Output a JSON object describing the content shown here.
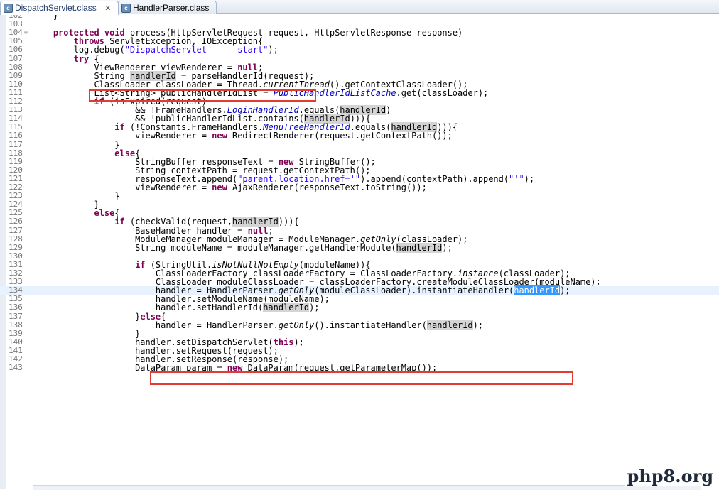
{
  "tabs": [
    {
      "label": "DispatchServlet.class",
      "icon": "class-file-icon",
      "active": true
    },
    {
      "label": "HandlerParser.class",
      "icon": "class-file-icon",
      "active": false
    }
  ],
  "watermark": "php8.org",
  "lines": [
    {
      "n": "102",
      "segs": [
        [
          "",
          "    }"
        ]
      ]
    },
    {
      "n": "103",
      "segs": []
    },
    {
      "n": "104",
      "fold": "⊖",
      "segs": [
        [
          "",
          "    "
        ],
        [
          "k",
          "protected"
        ],
        [
          "",
          " "
        ],
        [
          "k",
          "void"
        ],
        [
          "",
          " process(HttpServletRequest request, HttpServletResponse response)"
        ]
      ]
    },
    {
      "n": "105",
      "segs": [
        [
          "",
          "        "
        ],
        [
          "k",
          "throws"
        ],
        [
          "",
          " ServletException, IOException{"
        ]
      ]
    },
    {
      "n": "106",
      "segs": [
        [
          "",
          "        log.debug("
        ],
        [
          "s",
          "\"DispatchServlet------start\""
        ],
        [
          "",
          ");"
        ]
      ]
    },
    {
      "n": "107",
      "segs": [
        [
          "",
          "        "
        ],
        [
          "k",
          "try"
        ],
        [
          "",
          " {"
        ]
      ]
    },
    {
      "n": "108",
      "segs": [
        [
          "",
          "            ViewRenderer viewRenderer = "
        ],
        [
          "k",
          "null"
        ],
        [
          "",
          ";"
        ]
      ]
    },
    {
      "n": "109",
      "segs": [
        [
          "",
          "            String "
        ],
        [
          "occ",
          "handlerId"
        ],
        [
          "",
          " = parseHandlerId(request);"
        ]
      ]
    },
    {
      "n": "110",
      "segs": [
        [
          "",
          "            ClassLoader classLoader = Thread."
        ],
        [
          "i",
          "currentThread"
        ],
        [
          "",
          "().getContextClassLoader();"
        ]
      ]
    },
    {
      "n": "111",
      "segs": [
        [
          "",
          "            List<String> publicHandlerIdList = "
        ],
        [
          "f",
          "PublicHandlerIdListCache"
        ],
        [
          "",
          ".get(classLoader);"
        ]
      ]
    },
    {
      "n": "112",
      "segs": [
        [
          "",
          "            "
        ],
        [
          "k",
          "if"
        ],
        [
          "",
          " (isExpired(request)"
        ]
      ]
    },
    {
      "n": "113",
      "segs": [
        [
          "",
          "                    && !FrameHandlers."
        ],
        [
          "f",
          "LoginHandlerId"
        ],
        [
          "",
          ".equals("
        ],
        [
          "occ",
          "handlerId"
        ],
        [
          "",
          ")"
        ]
      ]
    },
    {
      "n": "114",
      "segs": [
        [
          "",
          "                    && !publicHandlerIdList.contains("
        ],
        [
          "occ",
          "handlerId"
        ],
        [
          "",
          "))){"
        ]
      ]
    },
    {
      "n": "115",
      "segs": [
        [
          "",
          "                "
        ],
        [
          "k",
          "if"
        ],
        [
          "",
          " (!Constants.FrameHandlers."
        ],
        [
          "f",
          "MenuTreeHandlerId"
        ],
        [
          "",
          ".equals("
        ],
        [
          "occ",
          "handlerId"
        ],
        [
          "",
          "))){"
        ]
      ]
    },
    {
      "n": "116",
      "segs": [
        [
          "",
          "                    viewRenderer = "
        ],
        [
          "k",
          "new"
        ],
        [
          "",
          " RedirectRenderer(request.getContextPath());"
        ]
      ]
    },
    {
      "n": "117",
      "segs": [
        [
          "",
          "                }"
        ]
      ]
    },
    {
      "n": "118",
      "segs": [
        [
          "",
          "                "
        ],
        [
          "k",
          "else"
        ],
        [
          "",
          "{"
        ]
      ]
    },
    {
      "n": "119",
      "segs": [
        [
          "",
          "                    StringBuffer responseText = "
        ],
        [
          "k",
          "new"
        ],
        [
          "",
          " StringBuffer();"
        ]
      ]
    },
    {
      "n": "120",
      "segs": [
        [
          "",
          "                    String contextPath = request.getContextPath();"
        ]
      ]
    },
    {
      "n": "121",
      "segs": [
        [
          "",
          "                    responseText.append("
        ],
        [
          "s",
          "\"parent.location.href='\""
        ],
        [
          "",
          ").append(contextPath).append("
        ],
        [
          "s",
          "\"'\""
        ],
        [
          "",
          ");"
        ]
      ]
    },
    {
      "n": "122",
      "segs": [
        [
          "",
          "                    viewRenderer = "
        ],
        [
          "k",
          "new"
        ],
        [
          "",
          " AjaxRenderer(responseText.toString());"
        ]
      ]
    },
    {
      "n": "123",
      "segs": [
        [
          "",
          "                }"
        ]
      ]
    },
    {
      "n": "124",
      "segs": [
        [
          "",
          "            }"
        ]
      ]
    },
    {
      "n": "125",
      "segs": [
        [
          "",
          "            "
        ],
        [
          "k",
          "else"
        ],
        [
          "",
          "{"
        ]
      ]
    },
    {
      "n": "126",
      "segs": [
        [
          "",
          "                "
        ],
        [
          "k",
          "if"
        ],
        [
          "",
          " (checkValid(request,"
        ],
        [
          "occ",
          "handlerId"
        ],
        [
          "",
          "))){"
        ]
      ]
    },
    {
      "n": "127",
      "segs": [
        [
          "",
          "                    BaseHandler handler = "
        ],
        [
          "k",
          "null"
        ],
        [
          "",
          ";"
        ]
      ]
    },
    {
      "n": "128",
      "segs": [
        [
          "",
          "                    ModuleManager moduleManager = ModuleManager."
        ],
        [
          "i",
          "getOnly"
        ],
        [
          "",
          "(classLoader);"
        ]
      ]
    },
    {
      "n": "129",
      "segs": [
        [
          "",
          "                    String moduleName = moduleManager.getHandlerModule("
        ],
        [
          "occ",
          "handlerId"
        ],
        [
          "",
          ");"
        ]
      ]
    },
    {
      "n": "130",
      "segs": []
    },
    {
      "n": "131",
      "segs": [
        [
          "",
          "                    "
        ],
        [
          "k",
          "if"
        ],
        [
          "",
          " (StringUtil."
        ],
        [
          "i",
          "isNotNullNotEmpty"
        ],
        [
          "",
          "(moduleName)){"
        ]
      ]
    },
    {
      "n": "132",
      "segs": [
        [
          "",
          "                        ClassLoaderFactory classLoaderFactory = ClassLoaderFactory."
        ],
        [
          "i",
          "instance"
        ],
        [
          "",
          "(classLoader);"
        ]
      ]
    },
    {
      "n": "133",
      "segs": [
        [
          "",
          "                        ClassLoader moduleClassLoader = classLoaderFactory.createModuleClassLoader(moduleName);"
        ]
      ]
    },
    {
      "n": "134",
      "current": true,
      "segs": [
        [
          "",
          "                        handler = HandlerParser."
        ],
        [
          "i",
          "getOnly"
        ],
        [
          "",
          "(moduleClassLoader).instantiateHandler("
        ],
        [
          "sel",
          "handlerId"
        ],
        [
          "",
          ");"
        ]
      ]
    },
    {
      "n": "135",
      "segs": [
        [
          "",
          "                        handler.setModuleName(moduleName);"
        ]
      ]
    },
    {
      "n": "136",
      "segs": [
        [
          "",
          "                        handler.setHandlerId("
        ],
        [
          "occ",
          "handlerId"
        ],
        [
          "",
          ");"
        ]
      ]
    },
    {
      "n": "137",
      "segs": [
        [
          "",
          "                    }"
        ],
        [
          "k",
          "else"
        ],
        [
          "",
          "{"
        ]
      ]
    },
    {
      "n": "138",
      "segs": [
        [
          "",
          "                        handler = HandlerParser."
        ],
        [
          "i",
          "getOnly"
        ],
        [
          "",
          "().instantiateHandler("
        ],
        [
          "occ",
          "handlerId"
        ],
        [
          "",
          ");"
        ]
      ]
    },
    {
      "n": "139",
      "segs": [
        [
          "",
          "                    }"
        ]
      ]
    },
    {
      "n": "140",
      "segs": [
        [
          "",
          "                    handler.setDispatchServlet("
        ],
        [
          "k",
          "this"
        ],
        [
          "",
          ");"
        ]
      ]
    },
    {
      "n": "141",
      "segs": [
        [
          "",
          "                    handler.setRequest(request);"
        ]
      ]
    },
    {
      "n": "142",
      "segs": [
        [
          "",
          "                    handler.setResponse(response);"
        ]
      ]
    },
    {
      "n": "143",
      "segs": [
        [
          "",
          "                    DataParam param = "
        ],
        [
          "k",
          "new"
        ],
        [
          "",
          " DataParam(request.getParameterMap());"
        ]
      ]
    }
  ]
}
